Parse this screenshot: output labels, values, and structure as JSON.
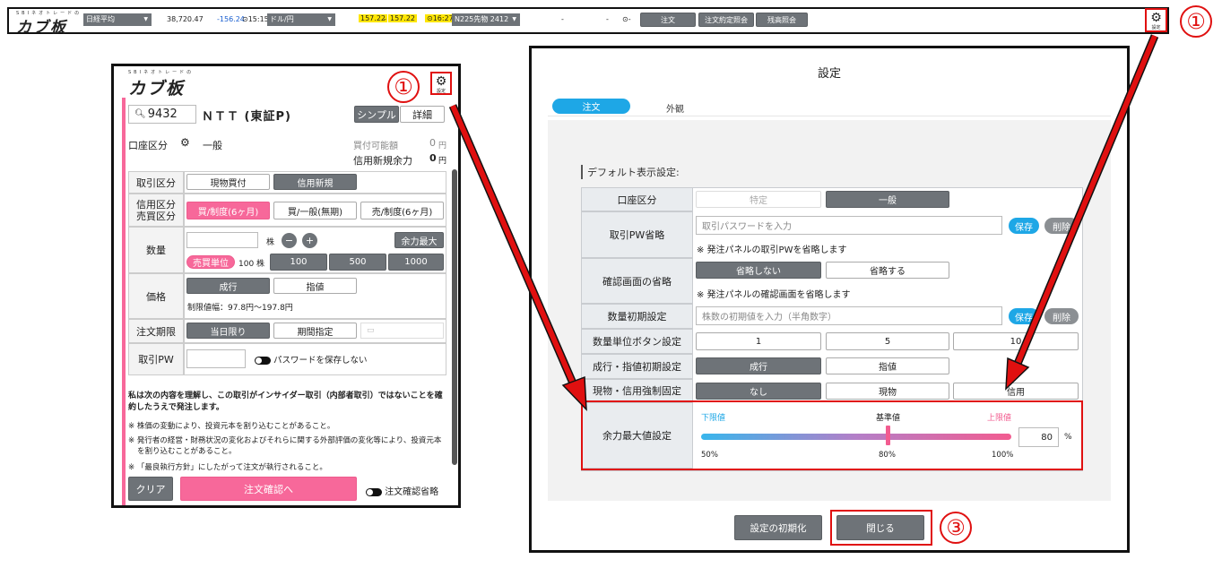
{
  "topbar": {
    "logo_sub": "SBIネオトレードの",
    "logo": "カブ板",
    "index_name": "日経平均",
    "index_value": "38,720.47",
    "index_change": "-156.24",
    "index_time": "⊙15:15",
    "fx_name": "ドル/円",
    "fx_bid": "157.22",
    "fx_sep": "-",
    "fx_ask": "157.22",
    "fx_time": "⊙16:27",
    "fut_name": "N225先物 2412",
    "fut_v1": "-",
    "fut_v2": "-",
    "fut_time": "⊙-",
    "btn_order": "注文",
    "btn_contract": "注文約定照会",
    "btn_balance": "残高照会",
    "settings_label": "設定"
  },
  "callouts": {
    "one": "①",
    "three": "③"
  },
  "panel": {
    "logo_sub": "SBIネオトレードの",
    "logo": "カブ板",
    "settings_label": "設定",
    "code": "9432",
    "name": "ＮＴＴ (東証P)",
    "simple": "シンプル",
    "detail": "詳細",
    "account_label": "口座区分",
    "account_value": "一般",
    "buy_power_label": "買付可能額",
    "buy_power_value": "0",
    "yen": "円",
    "margin_label": "信用新規余力",
    "margin_value": "0",
    "rows": {
      "trade_type": "取引区分",
      "spot_buy": "現物買付",
      "margin_new": "信用新規",
      "margin_type": "信用区分\n売買区分",
      "opt1": "買/制度(6ヶ月)",
      "opt2": "買/一般(無期)",
      "opt3": "売/制度(6ヶ月)",
      "qty": "数量",
      "unit": "株",
      "minus": "−",
      "plus": "+",
      "max": "余力最大",
      "lot_label": "売買単位",
      "lot_value": "100 株",
      "q100": "100",
      "q500": "500",
      "q1000": "1000",
      "price": "価格",
      "market": "成行",
      "limit": "指値",
      "range": "制限値幅：97.8円〜197.8円",
      "period": "注文期限",
      "today": "当日限り",
      "specify": "期間指定",
      "cal": "▭",
      "pw": "取引PW",
      "pw_save": "パスワードを保存しない"
    },
    "notice_bold": "私は次の内容を理解し、この取引がインサイダー取引（内部者取引）ではないことを確約したうえで発注します。",
    "notice1": "※ 株価の変動により、投資元本を割り込むことがあること。",
    "notice2": "※ 発行者の経営・財務状況の変化およびそれらに関する外部評価の変化等により、投資元本を割り込むことがあること。",
    "notice3": "※ 「最良執行方針」にしたがって注文が執行されること。",
    "clear": "クリア",
    "confirm": "注文確認へ",
    "skip_confirm": "注文確認省略"
  },
  "settings": {
    "title": "設定",
    "tab_order": "注文",
    "tab_look": "外観",
    "section": "デフォルト表示設定:",
    "acct_label": "口座区分",
    "acct_specific": "特定",
    "acct_general": "一般",
    "pw_label": "取引PW省略",
    "pw_placeholder": "取引パスワードを入力",
    "save": "保存",
    "del": "削除",
    "pw_note": "※ 発注パネルの取引PWを省略します",
    "confirm_label": "確認画面の省略",
    "no_skip": "省略しない",
    "skip": "省略する",
    "confirm_note": "※ 発注パネルの確認画面を省略します",
    "qty_label": "数量初期設定",
    "qty_placeholder": "株数の初期値を入力（半角数字）",
    "unitbtn_label": "数量単位ボタン設定",
    "u1": "1",
    "u2": "5",
    "u3": "10",
    "price_label": "成行・指値初期設定",
    "market": "成行",
    "limit": "指値",
    "force_label": "現物・信用強制固定",
    "none": "なし",
    "spot": "現物",
    "margin": "信用",
    "slider_label": "余力最大値設定",
    "lower": "下限値",
    "base": "基準値",
    "upper": "上限値",
    "slider_value": "80",
    "pct": "%",
    "p50": "50%",
    "p80": "80%",
    "p100": "100%",
    "reset": "設定の初期化",
    "close": "閉じる"
  },
  "slider_level": 0.6
}
